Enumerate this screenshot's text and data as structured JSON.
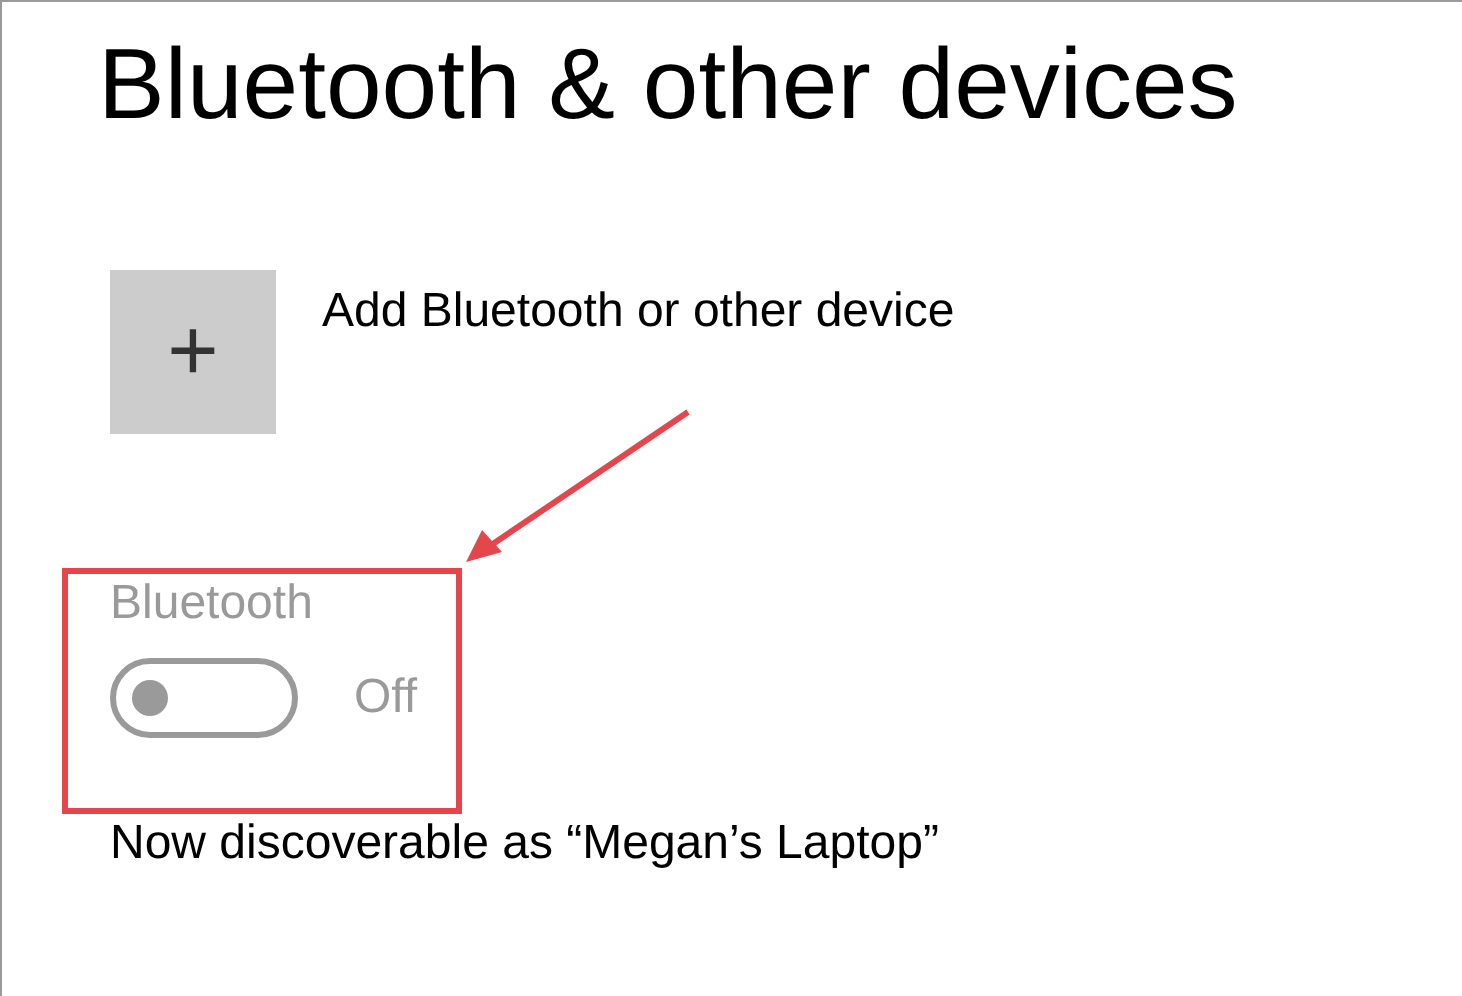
{
  "page": {
    "title": "Bluetooth & other devices"
  },
  "add_device": {
    "label": "Add Bluetooth or other device",
    "icon": "+"
  },
  "bluetooth": {
    "label": "Bluetooth",
    "on": false,
    "disabled": true,
    "state_text": "Off"
  },
  "discoverable": {
    "text": "Now discoverable as “Megan’s Laptop”"
  },
  "annotation": {
    "kind": "highlight"
  }
}
